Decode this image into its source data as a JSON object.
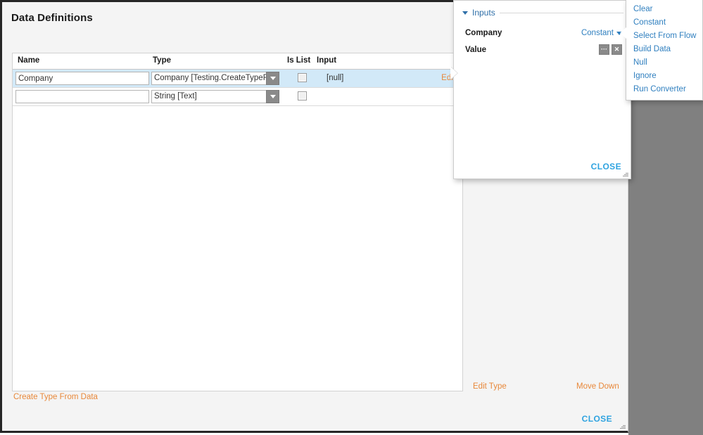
{
  "dialog": {
    "title": "Data Definitions",
    "create_type_link": "Create Type From Data",
    "edit_type_link": "Edit Type",
    "move_down_link": "Move Down",
    "close_label": "CLOSE"
  },
  "table": {
    "columns": [
      "Name",
      "Type",
      "Is List",
      "Input"
    ],
    "rows": [
      {
        "name": "Company",
        "type": "Company   [Testing.CreateTypeFrom",
        "is_list": false,
        "input": "[null]",
        "edit_label": "Edit",
        "selected": true
      },
      {
        "name": "",
        "name_placeholder": "",
        "type": "String [Text]",
        "is_list": false,
        "input": "",
        "edit_label": "",
        "selected": false
      }
    ]
  },
  "inputs_panel": {
    "section_label": "Inputs",
    "company_label": "Company",
    "company_value": "Constant",
    "value_label": "Value",
    "ellipsis_button": "···",
    "clear_button": "✕",
    "close_label": "CLOSE"
  },
  "context_menu": {
    "items": [
      "Clear",
      "Constant",
      "Select From Flow",
      "Build Data",
      "Null",
      "Ignore",
      "Run Converter"
    ]
  },
  "colors": {
    "accent_orange": "#e8883a",
    "accent_blue": "#2fa3e0",
    "link_blue": "#2f7fbf",
    "selected_row": "#d2e9f8",
    "backdrop_grey": "#808080"
  }
}
